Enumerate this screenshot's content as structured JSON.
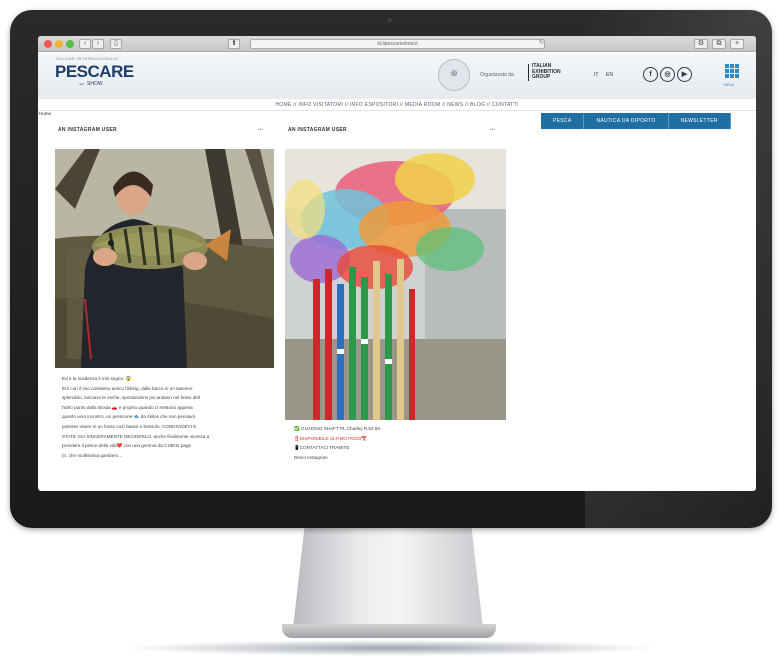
{
  "browser": {
    "address": "iit.ilpescareshow.it",
    "nav_back": "‹",
    "nav_fwd": "›",
    "share": "⬆",
    "tabs_btn": "⧉",
    "add_tab": "+"
  },
  "header": {
    "logo_top": "SALONE INTERNAZIONALE",
    "logo": "PESCARE",
    "logo_sub": "SHOW",
    "organized_by": "Organizzato da",
    "ieg": [
      "ITALIAN",
      "EXHIBITION",
      "GROUP"
    ],
    "lang_it": "IT",
    "lang_en": "EN",
    "social": [
      {
        "icon": "facebook-icon",
        "glyph": "f"
      },
      {
        "icon": "instagram-icon",
        "glyph": "◎"
      },
      {
        "icon": "youtube-icon",
        "glyph": "▶"
      }
    ],
    "menu_label": "MENU"
  },
  "nav": {
    "text": "HOME // INFO VISITATORI // INFO ESPOSITORI // MEDIA ROOM // NEWS // BLOG // CONTATTI"
  },
  "breadcrumb": "Home",
  "tabs": [
    "PESCA",
    "NAUTICA DA DIPORTO",
    "NEWSLETTER"
  ],
  "posts": [
    {
      "title": "AN INSTAGRAM USER",
      "more": "•••",
      "caption": [
        "Ed è la scadenza il mio sogno. 😱",
        "Ero con il mio carissimo amico fishing, dalle barca in un taserino",
        "splendido, lanciavo le esche, spostandomi poi andavo nel fosso dell",
        "l'altro punto dalla strada 🚗 e proprio quando ci mettono appena",
        "questo vero incontro, un persicone 🐟 da 4kilos che non pensavo",
        "potesse vivere in un fosso così basso e limitrofo. CONDIVIDEVI E",
        "STATE GIA SINCERAMENTE DECIDERLO, anche finalmente vicenza a",
        "prendere il pesce della vita❤️ con una gomma da CHIESI page",
        "(n. che moltissima gambero..."
      ]
    },
    {
      "title": "AN INSTAGRAM USER",
      "more": "•••",
      "caption": [
        "✅ GUADINO SHAFT PL Charley R.52.50",
        "‼️DISPONIBILE ULTIMO PEZZI📆",
        "📱CONTATTACI TRAMITE",
        "Direct Instagram"
      ]
    }
  ]
}
